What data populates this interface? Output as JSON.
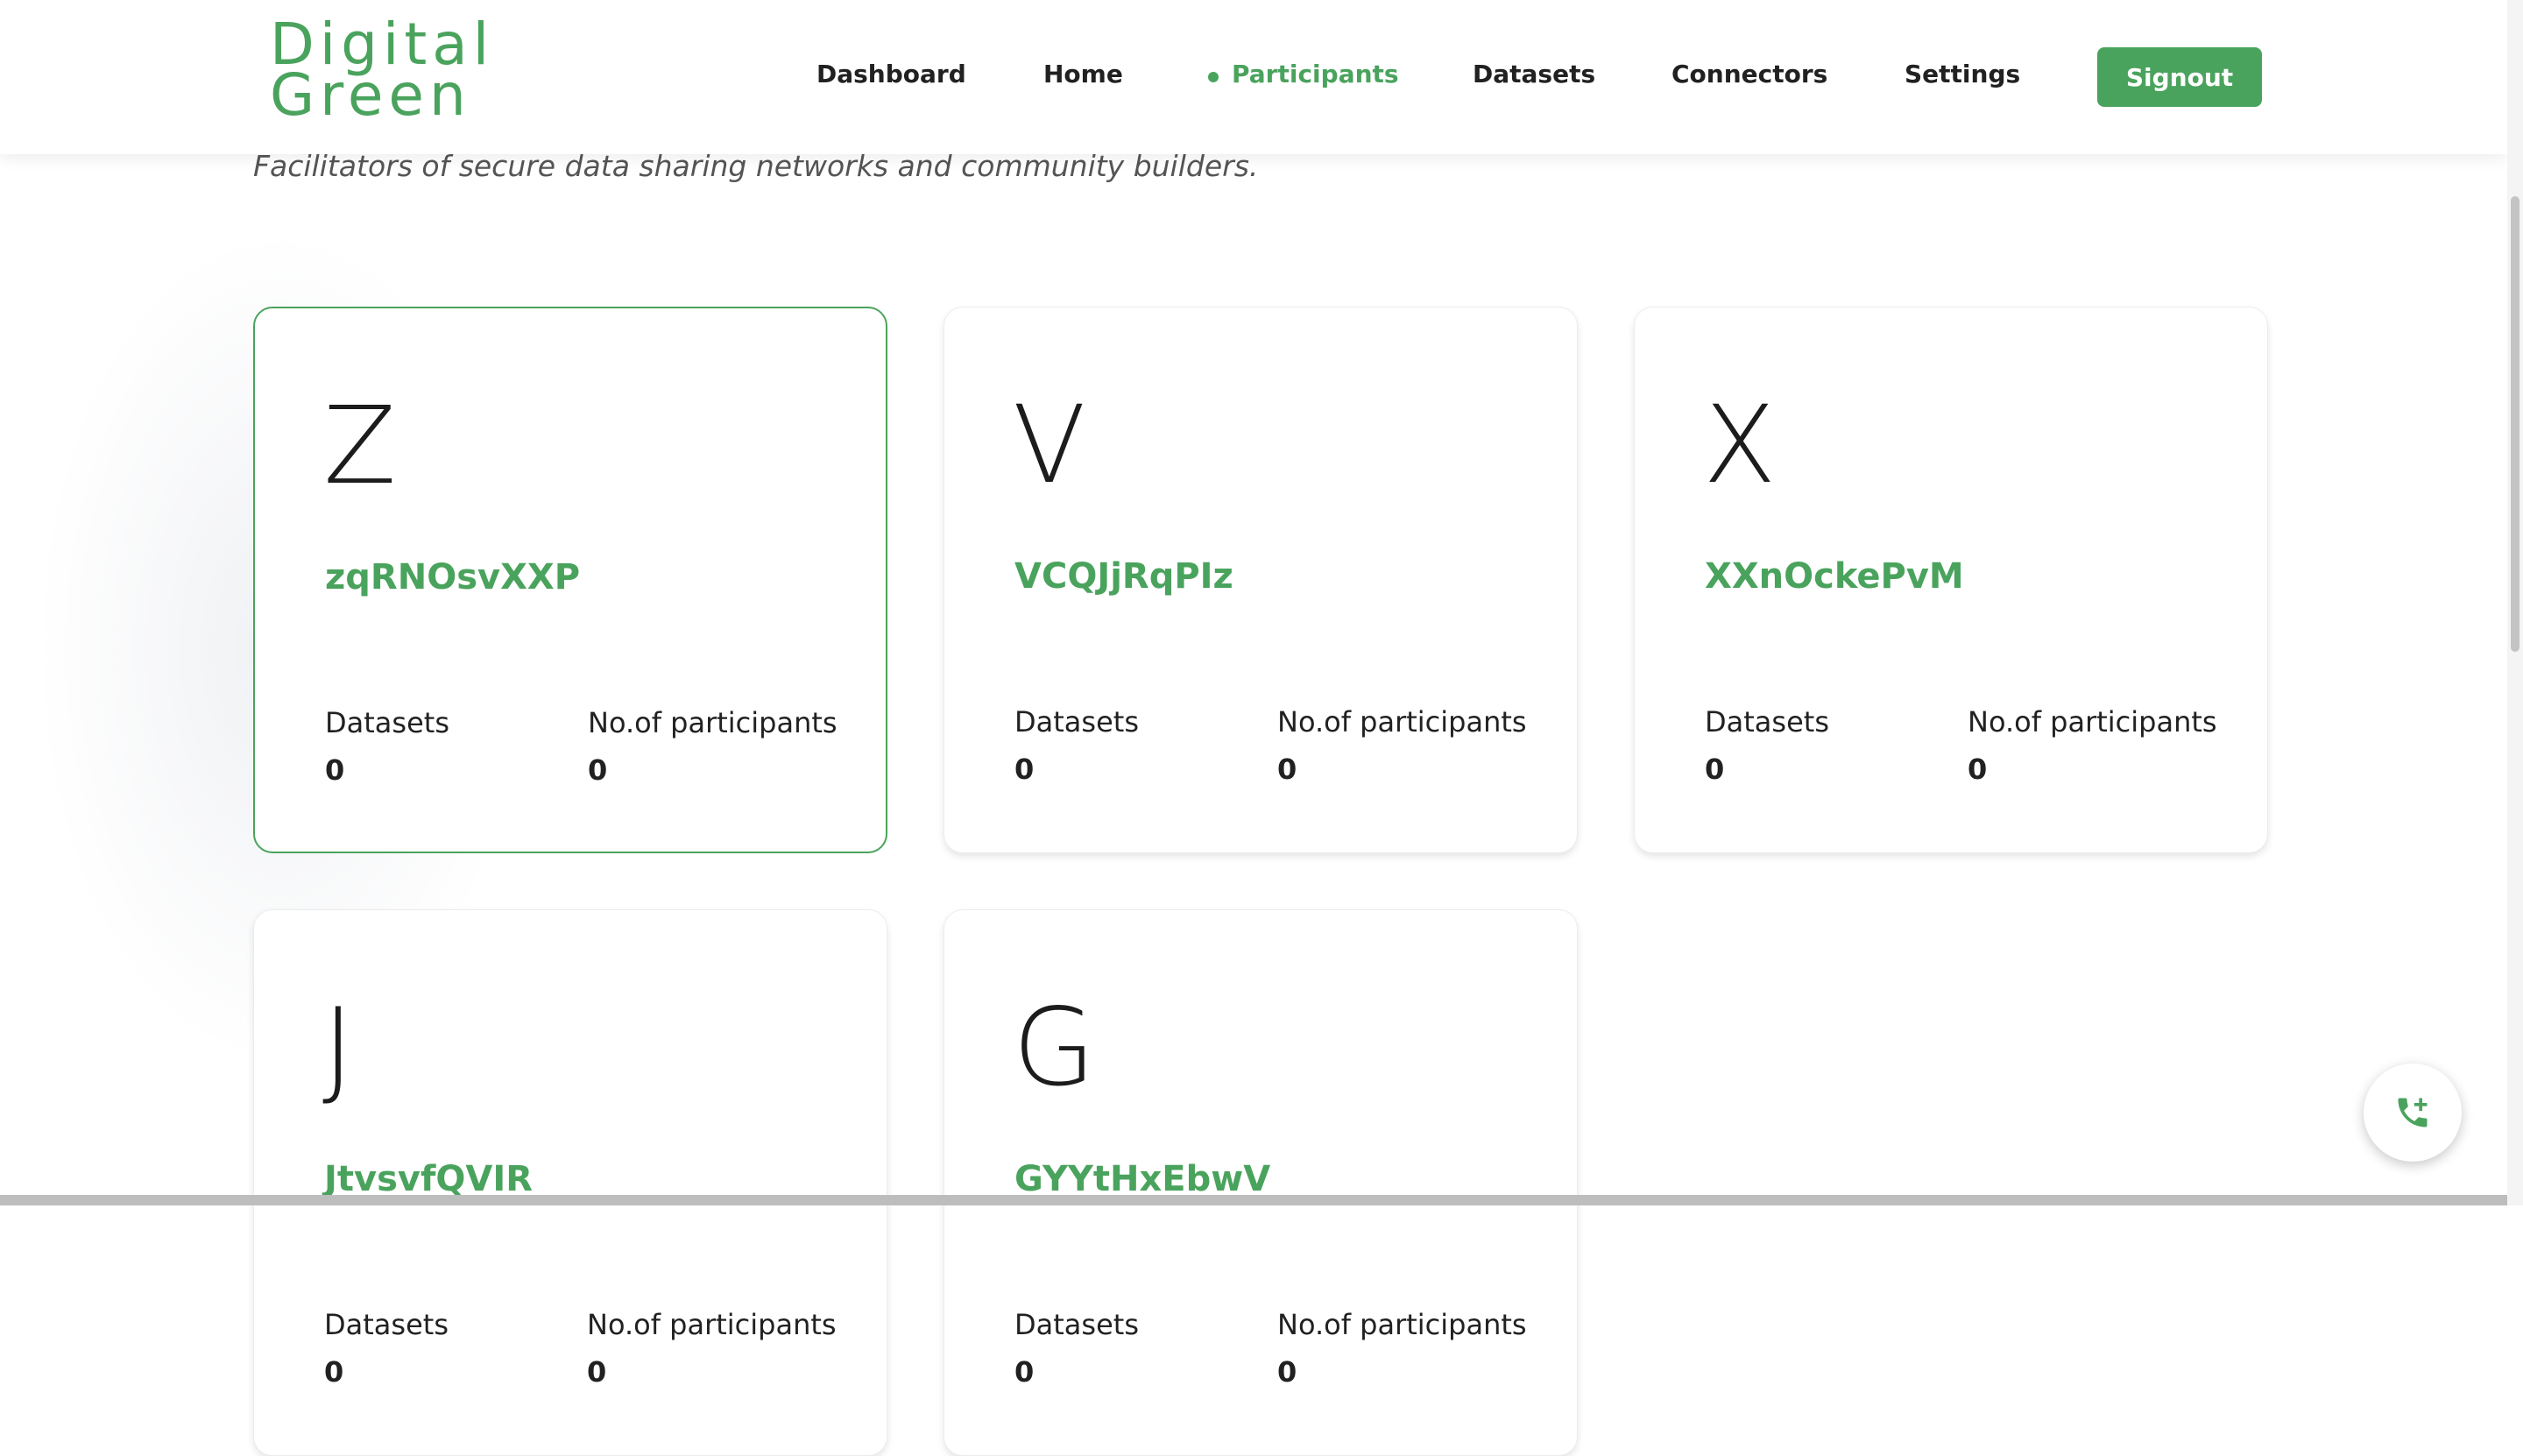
{
  "brand": {
    "logo_line1": "Digital",
    "logo_line2": "Green",
    "accent_color": "#4aa35d"
  },
  "nav": {
    "items": [
      {
        "label": "Dashboard",
        "active": false
      },
      {
        "label": "Home",
        "active": false
      },
      {
        "label": "Participants",
        "active": true
      },
      {
        "label": "Datasets",
        "active": false
      },
      {
        "label": "Connectors",
        "active": false
      },
      {
        "label": "Settings",
        "active": false
      }
    ],
    "signout_label": "Signout"
  },
  "page": {
    "subtitle": "Facilitators of secure data sharing networks and community builders."
  },
  "participants": [
    {
      "initial": "Z",
      "name": "zqRNOsvXXP",
      "datasets_label": "Datasets",
      "datasets": "0",
      "participants_label": "No.of participants",
      "participants": "0",
      "selected": true
    },
    {
      "initial": "V",
      "name": "VCQJjRqPIz",
      "datasets_label": "Datasets",
      "datasets": "0",
      "participants_label": "No.of participants",
      "participants": "0",
      "selected": false
    },
    {
      "initial": "X",
      "name": "XXnOckePvM",
      "datasets_label": "Datasets",
      "datasets": "0",
      "participants_label": "No.of participants",
      "participants": "0",
      "selected": false
    },
    {
      "initial": "J",
      "name": "JtvsvfQVIR",
      "datasets_label": "Datasets",
      "datasets": "0",
      "participants_label": "No.of participants",
      "participants": "0",
      "selected": false
    },
    {
      "initial": "G",
      "name": "GYYtHxEbwV",
      "datasets_label": "Datasets",
      "datasets": "0",
      "participants_label": "No.of participants",
      "participants": "0",
      "selected": false
    }
  ],
  "fab": {
    "icon": "phone-add-icon"
  }
}
